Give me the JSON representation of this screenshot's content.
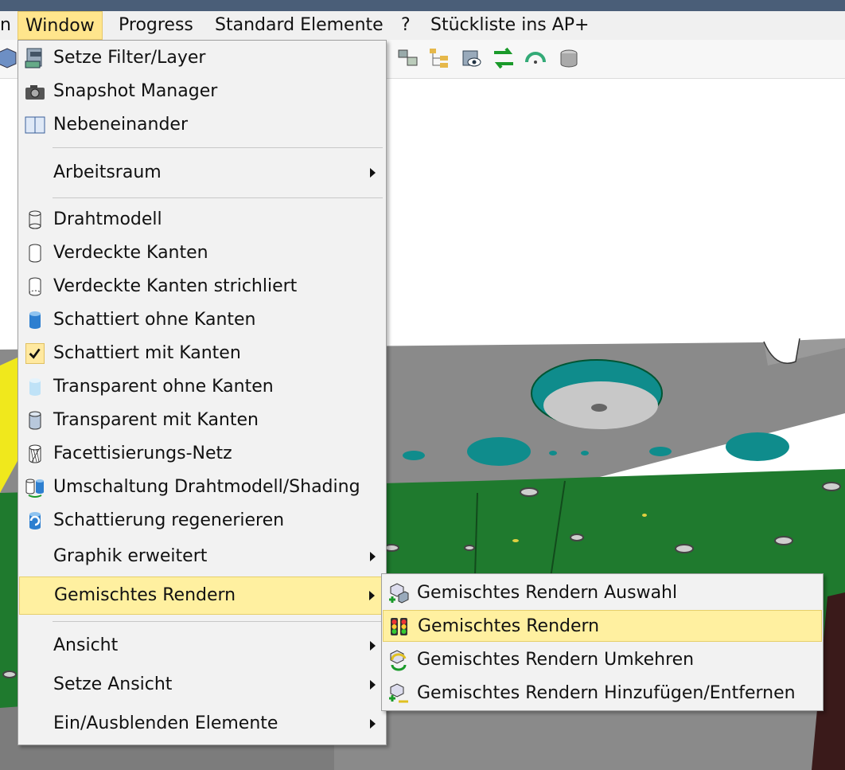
{
  "menubar": {
    "items": [
      {
        "label": "n",
        "active": false
      },
      {
        "label": "Window",
        "active": true
      },
      {
        "label": "Progress",
        "active": false
      },
      {
        "label": "Standard Elemente",
        "active": false
      },
      {
        "label": "?",
        "active": false
      },
      {
        "label": "Stückliste ins AP+",
        "active": false
      }
    ]
  },
  "window_menu": {
    "items": [
      {
        "label": "Setze Filter/Layer",
        "icon": "filter-layer-icon"
      },
      {
        "label": "Snapshot Manager",
        "icon": "camera-icon"
      },
      {
        "label": "Nebeneinander",
        "icon": "tile-windows-icon"
      },
      {
        "label": "Arbeitsraum",
        "submenu": true
      },
      {
        "label": "Drahtmodell",
        "icon": "wireframe-cylinder-icon"
      },
      {
        "label": "Verdeckte Kanten",
        "icon": "hidden-edges-cylinder-icon"
      },
      {
        "label": "Verdeckte Kanten strichliert",
        "icon": "dashed-edges-cylinder-icon"
      },
      {
        "label": "Schattiert ohne Kanten",
        "icon": "shaded-cylinder-icon"
      },
      {
        "label": "Schattiert mit Kanten",
        "icon": "checkmark-icon",
        "checked": true
      },
      {
        "label": "Transparent ohne Kanten",
        "icon": "transparent-cylinder-icon"
      },
      {
        "label": "Transparent mit Kanten",
        "icon": "transparent-edges-cylinder-icon"
      },
      {
        "label": "Facettisierungs-Netz",
        "icon": "mesh-cylinder-icon"
      },
      {
        "label": "Umschaltung Drahtmodell/Shading",
        "icon": "toggle-shading-icon"
      },
      {
        "label": "Schattierung regenerieren",
        "icon": "regenerate-shading-icon"
      },
      {
        "label": "Graphik erweitert",
        "submenu": true
      },
      {
        "label": "Gemischtes Rendern",
        "submenu": true,
        "highlighted": true
      },
      {
        "label": "Ansicht",
        "submenu": true
      },
      {
        "label": "Setze Ansicht",
        "submenu": true
      },
      {
        "label": "Ein/Ausblenden Elemente",
        "submenu": true
      }
    ]
  },
  "mixed_render_submenu": {
    "items": [
      {
        "label": "Gemischtes Rendern Auswahl",
        "icon": "mixed-render-select-icon"
      },
      {
        "label": "Gemischtes Rendern",
        "icon": "traffic-light-icon",
        "highlighted": true
      },
      {
        "label": "Gemischtes Rendern Umkehren",
        "icon": "mixed-render-invert-icon"
      },
      {
        "label": "Gemischtes Rendern Hinzufügen/Entfernen",
        "icon": "mixed-render-add-remove-icon"
      }
    ]
  },
  "colors": {
    "plate_grey": "#8a8a8a",
    "plate_green": "#1f7a2e",
    "hole_teal": "#0f8c8c",
    "highlight": "#fff0a0",
    "menu_bg": "#f2f2f2",
    "titlebar": "#4a5e78"
  }
}
